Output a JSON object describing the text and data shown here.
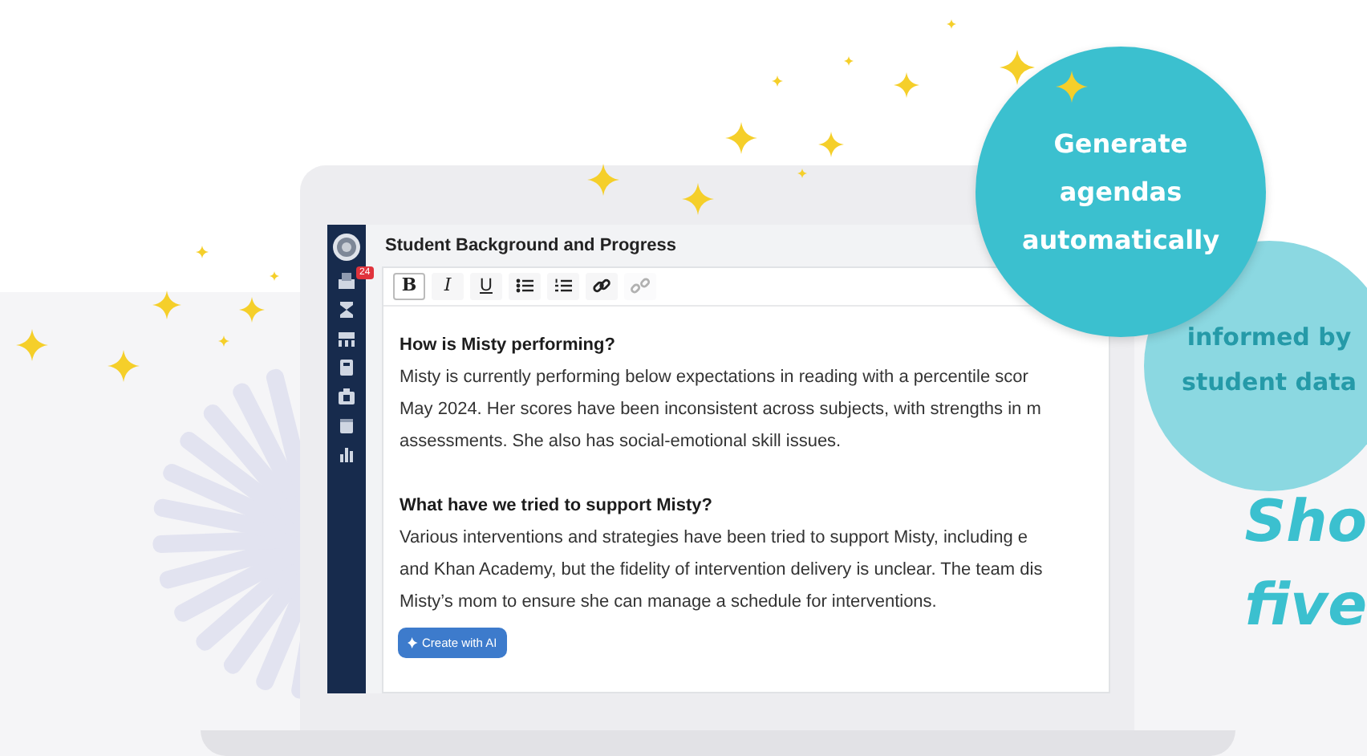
{
  "sidebar": {
    "badge": "24"
  },
  "editor": {
    "title": "Student Background and Progress",
    "toolbar": [
      {
        "kind": "bold",
        "label": "B",
        "active": true,
        "disabled": false
      },
      {
        "kind": "italic",
        "label": "I",
        "active": false,
        "disabled": false
      },
      {
        "kind": "underline",
        "label": "U",
        "active": false,
        "disabled": false
      },
      {
        "kind": "bullets",
        "active": false,
        "disabled": false
      },
      {
        "kind": "numbers",
        "active": false,
        "disabled": false
      },
      {
        "kind": "link",
        "active": false,
        "disabled": false
      },
      {
        "kind": "unlink",
        "active": false,
        "disabled": true
      }
    ],
    "sections": [
      {
        "heading": "How is Misty performing?",
        "lines": [
          "Misty is currently performing below expectations in reading with a percentile scor",
          "May 2024. Her scores have been inconsistent across subjects, with strengths in m",
          "assessments. She also has social-emotional skill issues."
        ]
      },
      {
        "heading": "What have we tried to support Misty?",
        "lines": [
          "Various interventions and strategies have been tried to support Misty, including e",
          "and Khan Academy, but the fidelity of intervention delivery is unclear. The team dis",
          "Misty’s mom to ensure she can manage a schedule for interventions."
        ]
      }
    ],
    "ai_button": "Create with AI"
  },
  "callouts": [
    {
      "kind": "primary",
      "lines": [
        "Generate",
        "agendas",
        "automatically"
      ]
    },
    {
      "kind": "secondary",
      "lines": [
        "informed by",
        "student data"
      ]
    }
  ],
  "headline": [
    "Sho",
    "five"
  ]
}
